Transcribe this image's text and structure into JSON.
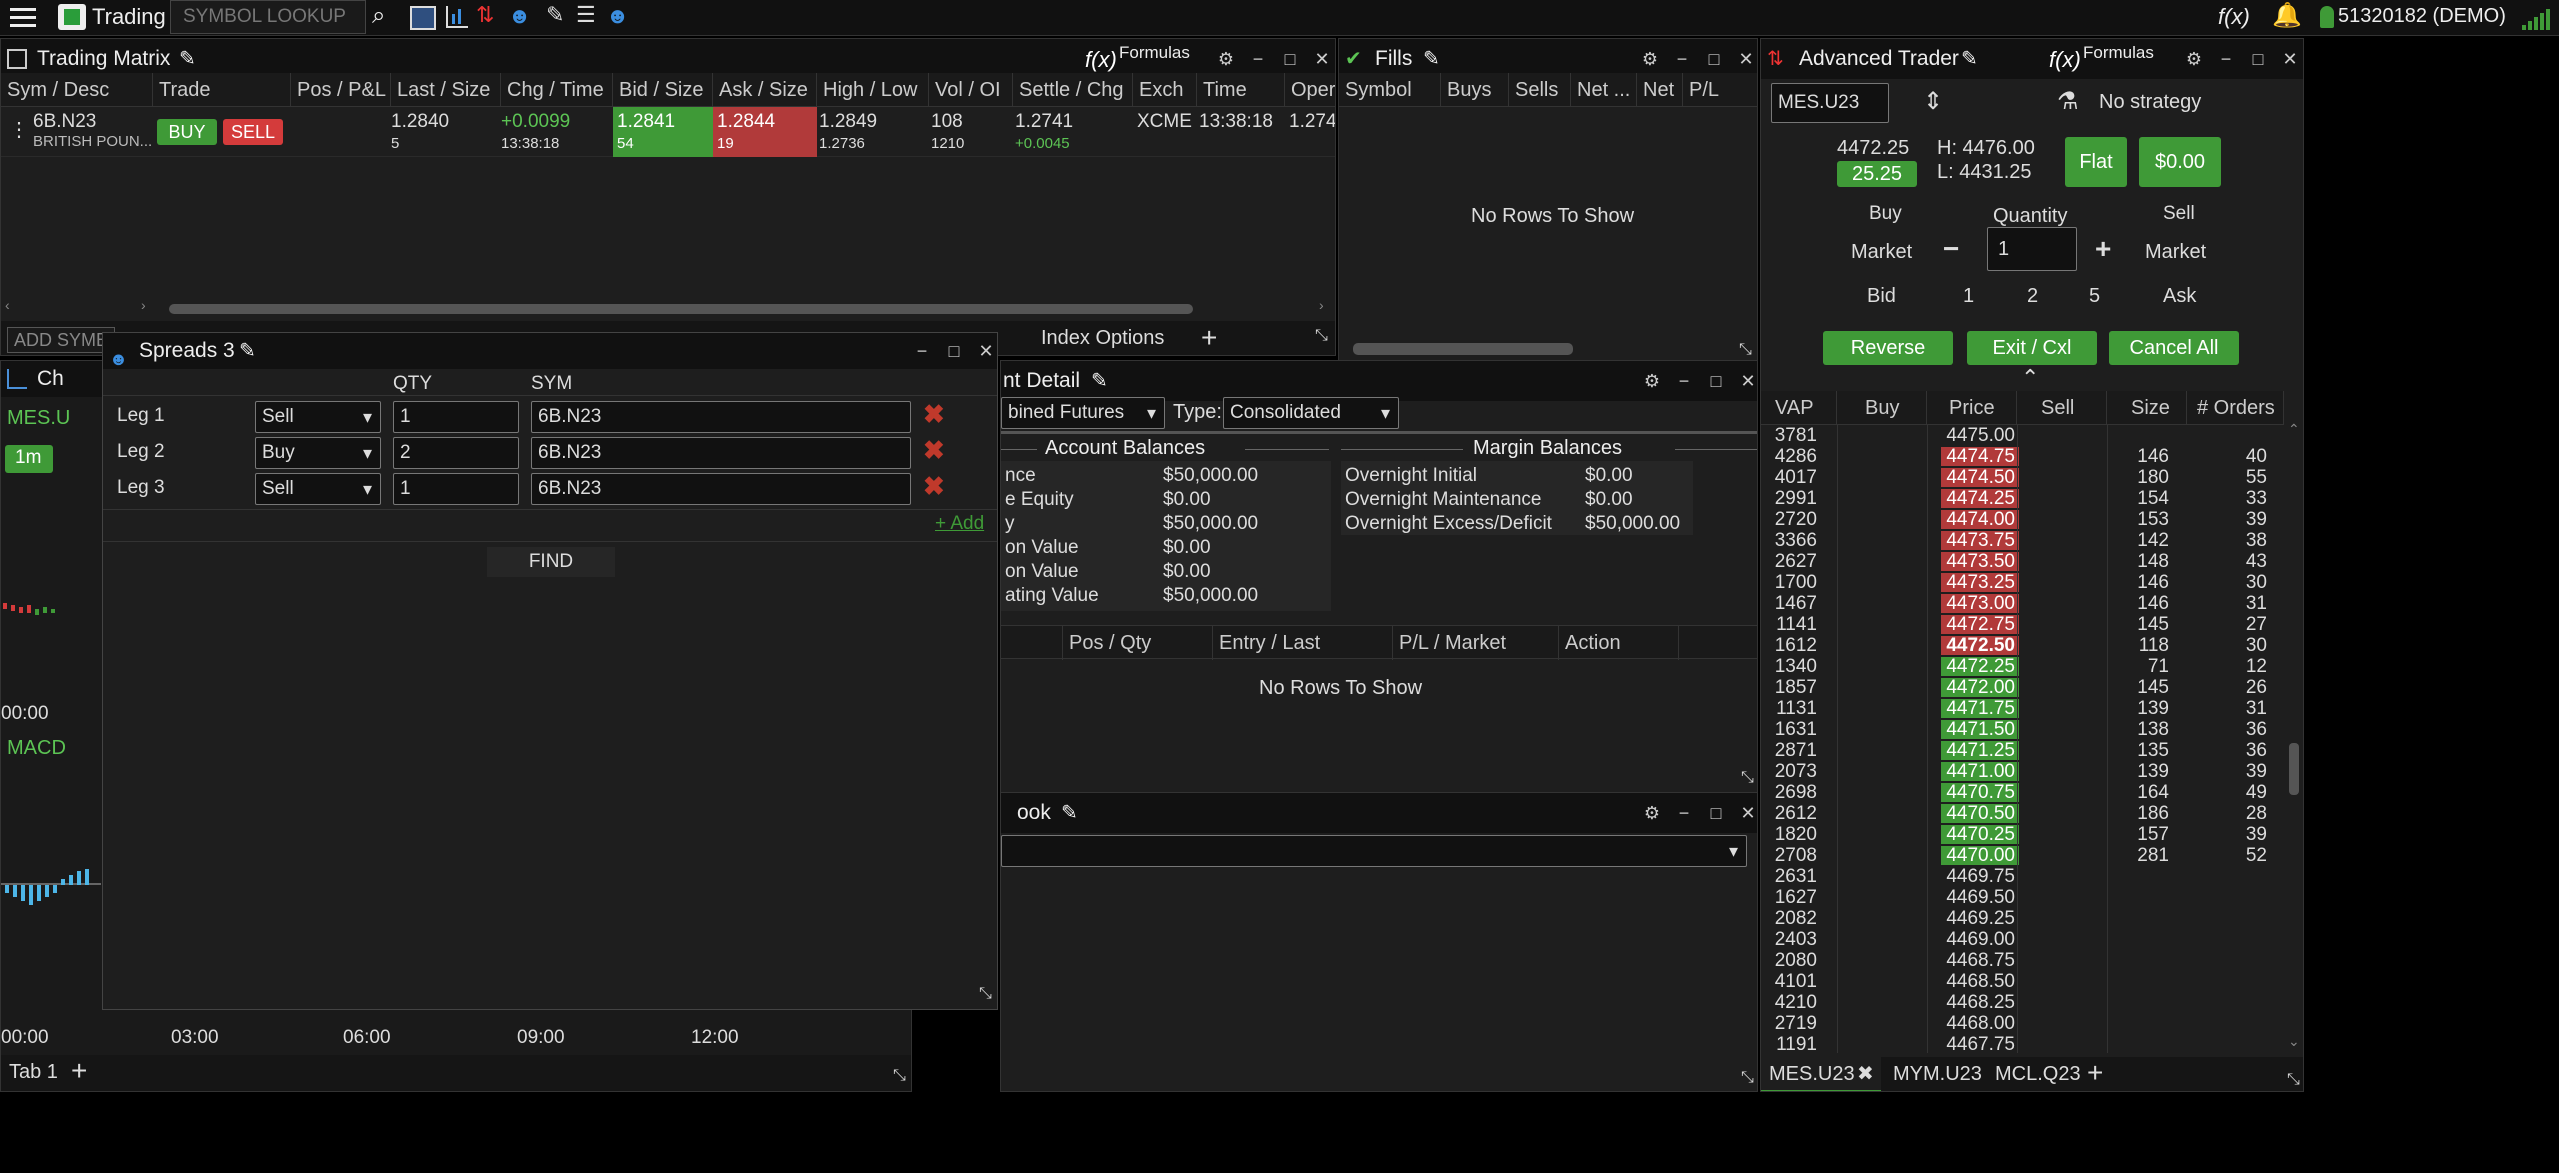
{
  "topbar": {
    "app": "Trading",
    "search_placeholder": "SYMBOL LOOKUP",
    "account": "51320182 (DEMO)",
    "fx": "f(x)"
  },
  "matrix": {
    "title": "Trading Matrix",
    "formulas": "Formulas",
    "fx": "f(x)",
    "headers": [
      "Sym / Desc",
      "Trade",
      "Pos / P&L",
      "Last / Size",
      "Chg / Time",
      "Bid / Size",
      "Ask / Size",
      "High / Low",
      "Vol / OI",
      "Settle / Chg",
      "Exch",
      "Time",
      "Oper"
    ],
    "row": {
      "sym": "6B.N23",
      "desc": "BRITISH POUN...",
      "buy": "BUY",
      "sell": "SELL",
      "last": "1.2840",
      "last_size": "5",
      "chg": "+0.0099",
      "chg_time": "13:38:18",
      "bid": "1.2841",
      "bid_size": "54",
      "ask": "1.2844",
      "ask_size": "19",
      "high": "1.2849",
      "low": "1.2736",
      "vol": "108",
      "oi": "1210",
      "settle": "1.2741",
      "settle_chg": "+0.0045",
      "exch": "XCME",
      "time": "13:38:18",
      "open": "1.274"
    },
    "tabs": {
      "add": "ADD SYMB",
      "index_options": "Index Options"
    }
  },
  "fills": {
    "title": "Fills",
    "headers": [
      "Symbol",
      "Buys",
      "Sells",
      "Net ...",
      "Net",
      "P/L"
    ],
    "empty": "No Rows To Show"
  },
  "spreads": {
    "title": "Spreads 3",
    "headers": {
      "qty": "QTY",
      "sym": "SYM"
    },
    "legs": [
      {
        "label": "Leg 1",
        "side": "Sell",
        "qty": "1",
        "sym": "6B.N23"
      },
      {
        "label": "Leg 2",
        "side": "Buy",
        "qty": "2",
        "sym": "6B.N23"
      },
      {
        "label": "Leg 3",
        "side": "Sell",
        "qty": "1",
        "sym": "6B.N23"
      }
    ],
    "add": "+ Add",
    "find": "FIND"
  },
  "account_detail": {
    "title": "nt Detail",
    "account_select": "bined Futures",
    "type_label": "Type:",
    "type_value": "Consolidated",
    "account_balances": "Account Balances",
    "margin_balances": "Margin Balances",
    "left": [
      {
        "label": "nce",
        "value": "$50,000.00"
      },
      {
        "label": "e Equity",
        "value": "$0.00"
      },
      {
        "label": "y",
        "value": "$50,000.00"
      },
      {
        "label": "on Value",
        "value": "$0.00"
      },
      {
        "label": "on Value",
        "value": "$0.00"
      },
      {
        "label": "ating Value",
        "value": "$50,000.00"
      }
    ],
    "right": [
      {
        "label": "Overnight Initial",
        "value": "$0.00"
      },
      {
        "label": "Overnight Maintenance",
        "value": "$0.00"
      },
      {
        "label": "Overnight Excess/Deficit",
        "value": "$50,000.00"
      }
    ],
    "pos_headers": [
      "Pos / Qty",
      "Entry / Last",
      "P/L / Market",
      "Action"
    ],
    "empty": "No Rows To Show"
  },
  "book": {
    "title": "ook"
  },
  "chart": {
    "title": "Ch",
    "symbol": "MES.U",
    "interval": "1m",
    "macd": "MACD",
    "times": [
      "00:00",
      "00:00",
      "03:00",
      "06:00",
      "09:00",
      "12:00"
    ],
    "tab": "Tab 1"
  },
  "trader": {
    "title": "Advanced Trader",
    "formulas": "Formulas",
    "fx": "f(x)",
    "symbol": "MES.U23",
    "strategy": "No strategy",
    "last": "4472.25",
    "change": "25.25",
    "high": "H: 4476.00",
    "low": "L: 4431.25",
    "flat": "Flat",
    "pnl": "$0.00",
    "buy": "Buy",
    "sell": "Sell",
    "quantity": "Quantity",
    "market_l": "Market",
    "market_r": "Market",
    "qty": "1",
    "bid": "Bid",
    "ask": "Ask",
    "q1": "1",
    "q2": "2",
    "q5": "5",
    "reverse": "Reverse",
    "exit": "Exit / Cxl",
    "cancel": "Cancel All",
    "headers": [
      "VAP",
      "Buy",
      "Price",
      "Sell",
      "Size",
      "# Orders"
    ],
    "rows": [
      {
        "vap": "3781",
        "price": "4475.00",
        "size": "",
        "orders": "",
        "t": "n"
      },
      {
        "vap": "4286",
        "price": "4474.75",
        "size": "146",
        "orders": "40",
        "t": "a"
      },
      {
        "vap": "4017",
        "price": "4474.50",
        "size": "180",
        "orders": "55",
        "t": "a"
      },
      {
        "vap": "2991",
        "price": "4474.25",
        "size": "154",
        "orders": "33",
        "t": "a"
      },
      {
        "vap": "2720",
        "price": "4474.00",
        "size": "153",
        "orders": "39",
        "t": "a"
      },
      {
        "vap": "3366",
        "price": "4473.75",
        "size": "142",
        "orders": "38",
        "t": "a"
      },
      {
        "vap": "2627",
        "price": "4473.50",
        "size": "148",
        "orders": "43",
        "t": "a"
      },
      {
        "vap": "1700",
        "price": "4473.25",
        "size": "146",
        "orders": "30",
        "t": "a"
      },
      {
        "vap": "1467",
        "price": "4473.00",
        "size": "146",
        "orders": "31",
        "t": "a"
      },
      {
        "vap": "1141",
        "price": "4472.75",
        "size": "145",
        "orders": "27",
        "t": "a"
      },
      {
        "vap": "1612",
        "price": "4472.50",
        "size": "118",
        "orders": "30",
        "t": "ab"
      },
      {
        "vap": "1340",
        "price": "4472.25",
        "size": "71",
        "orders": "12",
        "t": "b"
      },
      {
        "vap": "1857",
        "price": "4472.00",
        "size": "145",
        "orders": "26",
        "t": "b"
      },
      {
        "vap": "1131",
        "price": "4471.75",
        "size": "139",
        "orders": "31",
        "t": "b"
      },
      {
        "vap": "1631",
        "price": "4471.50",
        "size": "138",
        "orders": "36",
        "t": "b"
      },
      {
        "vap": "2871",
        "price": "4471.25",
        "size": "135",
        "orders": "36",
        "t": "b"
      },
      {
        "vap": "2073",
        "price": "4471.00",
        "size": "139",
        "orders": "39",
        "t": "b"
      },
      {
        "vap": "2698",
        "price": "4470.75",
        "size": "164",
        "orders": "49",
        "t": "b"
      },
      {
        "vap": "2612",
        "price": "4470.50",
        "size": "186",
        "orders": "28",
        "t": "b"
      },
      {
        "vap": "1820",
        "price": "4470.25",
        "size": "157",
        "orders": "39",
        "t": "b"
      },
      {
        "vap": "2708",
        "price": "4470.00",
        "size": "281",
        "orders": "52",
        "t": "b"
      },
      {
        "vap": "2631",
        "price": "4469.75",
        "size": "",
        "orders": "",
        "t": "n"
      },
      {
        "vap": "1627",
        "price": "4469.50",
        "size": "",
        "orders": "",
        "t": "n"
      },
      {
        "vap": "2082",
        "price": "4469.25",
        "size": "",
        "orders": "",
        "t": "n"
      },
      {
        "vap": "2403",
        "price": "4469.00",
        "size": "",
        "orders": "",
        "t": "n"
      },
      {
        "vap": "2080",
        "price": "4468.75",
        "size": "",
        "orders": "",
        "t": "n"
      },
      {
        "vap": "4101",
        "price": "4468.50",
        "size": "",
        "orders": "",
        "t": "n"
      },
      {
        "vap": "4210",
        "price": "4468.25",
        "size": "",
        "orders": "",
        "t": "n"
      },
      {
        "vap": "2719",
        "price": "4468.00",
        "size": "",
        "orders": "",
        "t": "n"
      },
      {
        "vap": "1191",
        "price": "4467.75",
        "size": "",
        "orders": "",
        "t": "n"
      }
    ],
    "tabs": [
      "MES.U23",
      "MYM.U23",
      "MCL.Q23"
    ]
  }
}
